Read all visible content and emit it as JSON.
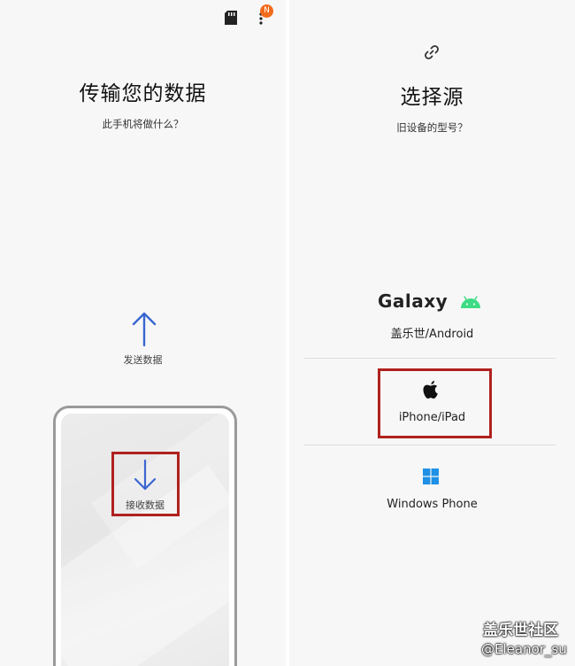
{
  "left_screen": {
    "title": "传输您的数据",
    "subtitle": "此手机将做什么？",
    "notification_badge": "N",
    "send": {
      "icon": "arrow-up-icon",
      "label": "发送数据"
    },
    "receive": {
      "icon": "arrow-down-icon",
      "label": "接收数据",
      "highlighted": true
    }
  },
  "right_screen": {
    "title": "选择源",
    "subtitle": "旧设备的型号？",
    "options": [
      {
        "logo_text": "Galaxy",
        "icon": "android-icon",
        "label": "盖乐世/Android"
      },
      {
        "icon": "apple-icon",
        "label": "iPhone/iPad",
        "highlighted": true
      },
      {
        "icon": "windows-icon",
        "label": "Windows Phone"
      }
    ]
  },
  "watermark": {
    "line1": "盖乐世社区",
    "line2": "@Eleanor_su"
  },
  "colors": {
    "accent_blue": "#3a66d1",
    "highlight_red": "#b0211e",
    "badge_orange": "#f26b1d",
    "android_green": "#3ddc84",
    "windows_blue": "#1e90e6"
  }
}
